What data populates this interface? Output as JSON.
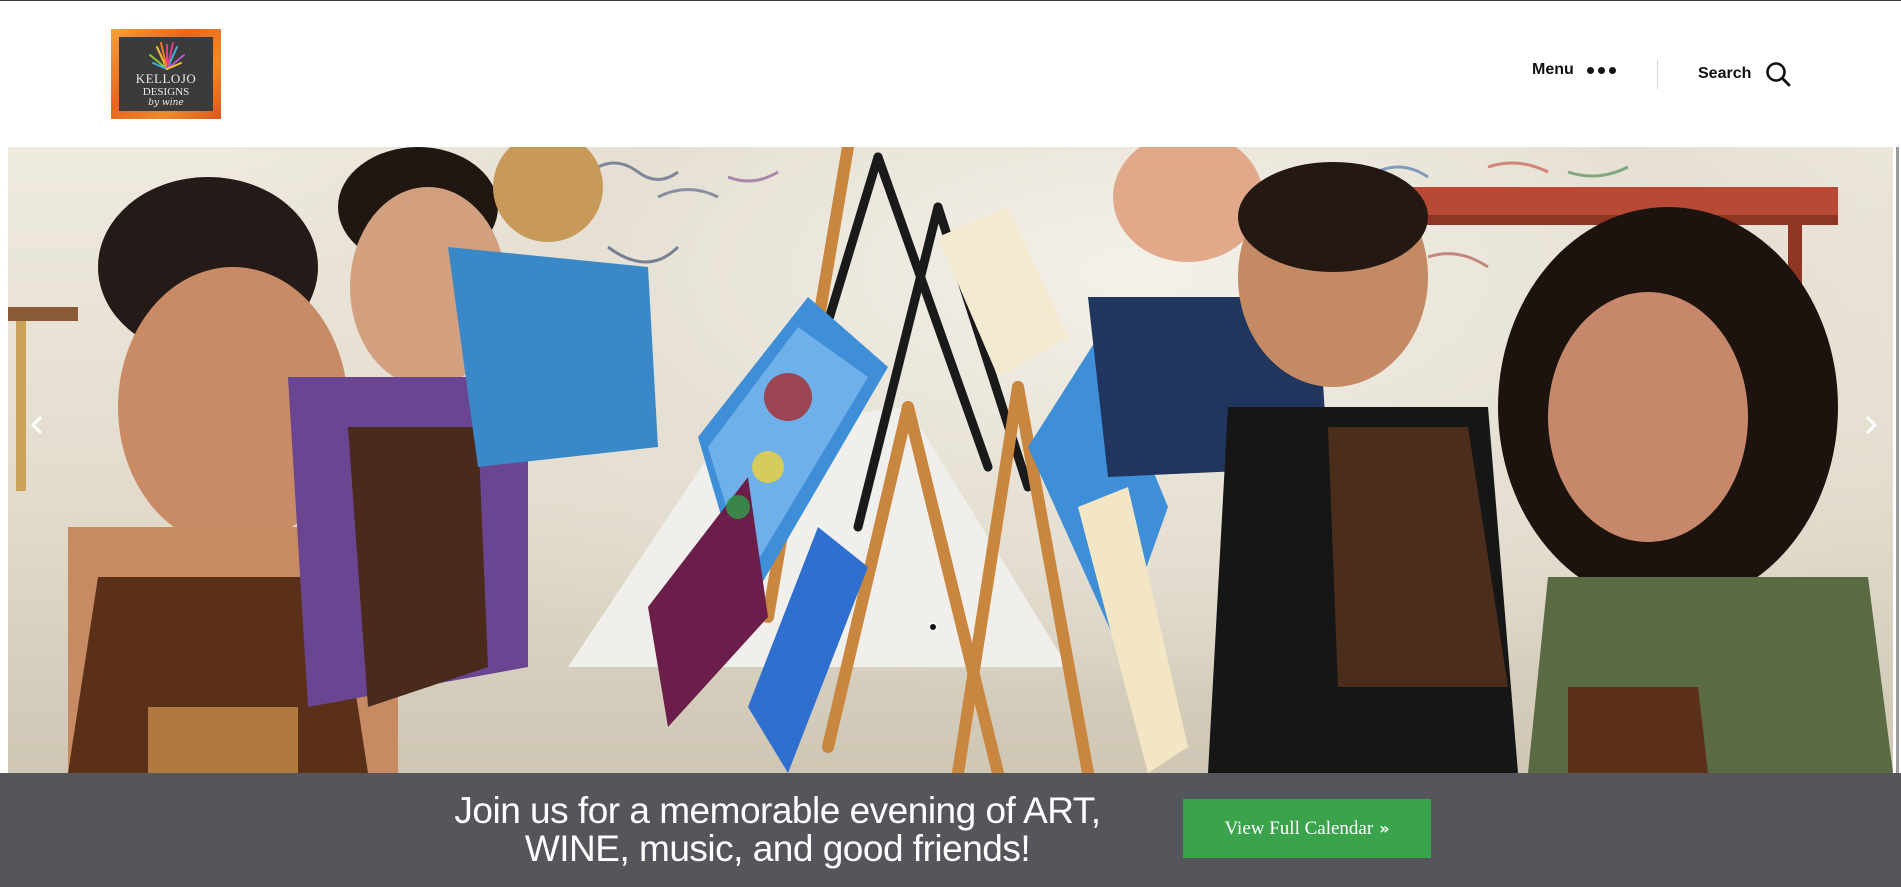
{
  "header": {
    "logo": {
      "line1": "KELLOJO",
      "line2": "DESIGNS",
      "line3": "by wine",
      "icon": "paint-burst-logo"
    },
    "menu_label": "Menu",
    "menu_icon": "more-dots-icon",
    "search_label": "Search",
    "search_icon": "search-icon"
  },
  "hero": {
    "image": "Smiling people painting on canvases at easels in a painting class",
    "prev_icon": "chevron-left-icon",
    "next_icon": "chevron-right-icon",
    "active_slide": 1
  },
  "cta": {
    "text_line1": "Join us for a memorable evening of ART,",
    "text_line2": "WINE, music, and good friends!",
    "button_label": "View Full Calendar",
    "button_icon": "double-chevron-right-icon",
    "button_color": "#3aa34b",
    "bar_color": "#55565b"
  }
}
